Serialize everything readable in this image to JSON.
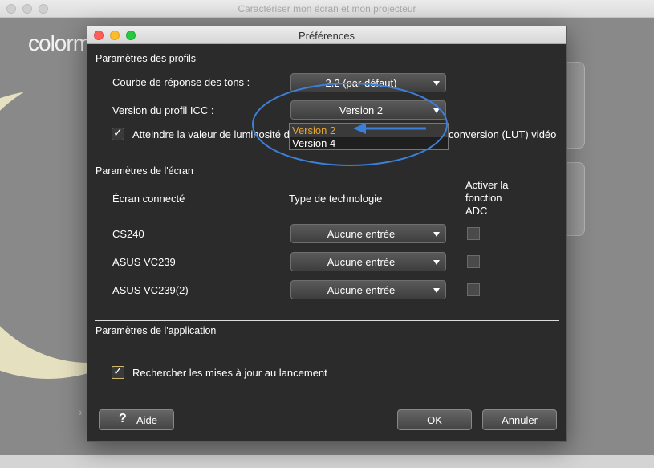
{
  "background_window": {
    "title": "Caractériser mon écran et mon projecteur",
    "logo_text": "colorm"
  },
  "dialog": {
    "title": "Préférences",
    "profiles_section": {
      "title": "Paramètres des profils",
      "tone_curve_label": "Courbe de réponse des tons :",
      "tone_curve_value": "2.2 (par défaut)",
      "icc_version_label": "Version du profil ICC :",
      "icc_version_value": "Version 2",
      "luminance_label_left": "Atteindre la valeur de luminosité d",
      "luminance_label_right": "conversion (LUT) vidéo",
      "luminance_checked": true,
      "icc_dropdown_options": [
        "Version 2",
        "Version 4"
      ],
      "icc_dropdown_selected": "Version 2"
    },
    "screen_section": {
      "title": "Paramètres de l'écran",
      "col_screen": "Écran connecté",
      "col_tech": "Type de technologie",
      "col_adc_line1": "Activer la",
      "col_adc_line2": "fonction",
      "col_adc_line3": "ADC",
      "rows": [
        {
          "name": "CS240",
          "tech": "Aucune entrée",
          "adc": false
        },
        {
          "name": "ASUS VC239",
          "tech": "Aucune entrée",
          "adc": false
        },
        {
          "name": "ASUS VC239(2)",
          "tech": "Aucune entrée",
          "adc": false
        }
      ]
    },
    "app_section": {
      "title": "Paramètres de l'application",
      "check_updates_label": "Rechercher les mises à jour au lancement",
      "check_updates_checked": true
    },
    "buttons": {
      "help": "Aide",
      "ok": "OK",
      "cancel": "Annuler"
    },
    "icons": {
      "help": "question-mark-icon",
      "caret": "chevron-down-icon",
      "check": "checkmark-icon"
    }
  },
  "colors": {
    "annotation_blue": "#3b7fd8",
    "selected_option": "#e8a531",
    "dialog_bg": "#2b2b2b"
  }
}
